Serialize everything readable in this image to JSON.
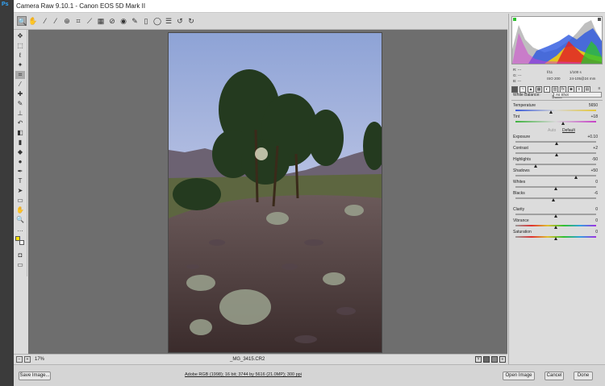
{
  "window": {
    "app_icon": "Ps",
    "title": "Camera Raw 9.10.1  -  Canon EOS 5D Mark II"
  },
  "toolbar": {
    "tools": [
      "zoom-icon",
      "hand-icon",
      "white-balance-icon",
      "color-sampler-icon",
      "targeted-adjustment-icon",
      "crop-icon",
      "straighten-icon",
      "transform-icon",
      "spot-removal-icon",
      "red-eye-icon",
      "adjustment-brush-icon",
      "graduated-filter-icon",
      "radial-filter-icon",
      "preferences-icon",
      "rotate-ccw-icon",
      "rotate-cw-icon"
    ]
  },
  "canvas": {
    "filename": "_MG_3415.CR2",
    "zoom": "17%"
  },
  "footer": {
    "save_label": "Save Image...",
    "workflow_link": "Adobe RGB (1998); 16 bit; 3744 by 5616 (21.0MP); 300 ppi",
    "open_label": "Open Image",
    "cancel_label": "Cancel",
    "done_label": "Done"
  },
  "info": {
    "r": "R:  ---",
    "g": "G:  ---",
    "b": "B:  ---",
    "aperture": "f/11",
    "shutter": "1/100 s",
    "iso": "ISO 200",
    "lens": "24-105@24 mm"
  },
  "panel": {
    "title": "Basic",
    "white_balance_label": "White Balance:",
    "white_balance_value": "As Shot",
    "auto_label": "Auto",
    "default_label": "Default"
  },
  "sliders": [
    {
      "label": "Temperature",
      "value": "5650",
      "level": 0.44
    },
    {
      "label": "Tint",
      "value": "+18",
      "level": 0.59
    },
    {
      "label": "Exposure",
      "value": "+0.10",
      "level": 0.51
    },
    {
      "label": "Contrast",
      "value": "+2",
      "level": 0.51
    },
    {
      "label": "Highlights",
      "value": "-50",
      "level": 0.25
    },
    {
      "label": "Shadows",
      "value": "+50",
      "level": 0.75
    },
    {
      "label": "Whites",
      "value": "0",
      "level": 0.5
    },
    {
      "label": "Blacks",
      "value": "-6",
      "level": 0.47
    },
    {
      "label": "Clarity",
      "value": "0",
      "level": 0.5
    },
    {
      "label": "Vibrance",
      "value": "0",
      "level": 0.5
    },
    {
      "label": "Saturation",
      "value": "0",
      "level": 0.5
    }
  ],
  "colors": {
    "temperature_track": "linear-gradient(90deg,#3b5bd8,#d8d8d8,#e3c63a)",
    "tint_track": "linear-gradient(90deg,#3fb23f,#d8d8d8,#c642c6)",
    "vibrance_track": "linear-gradient(90deg,#9a9a9a,#e03030,#e0c030,#30c030,#30a0e0,#a030e0)",
    "default_track": "#a0a0a0"
  }
}
